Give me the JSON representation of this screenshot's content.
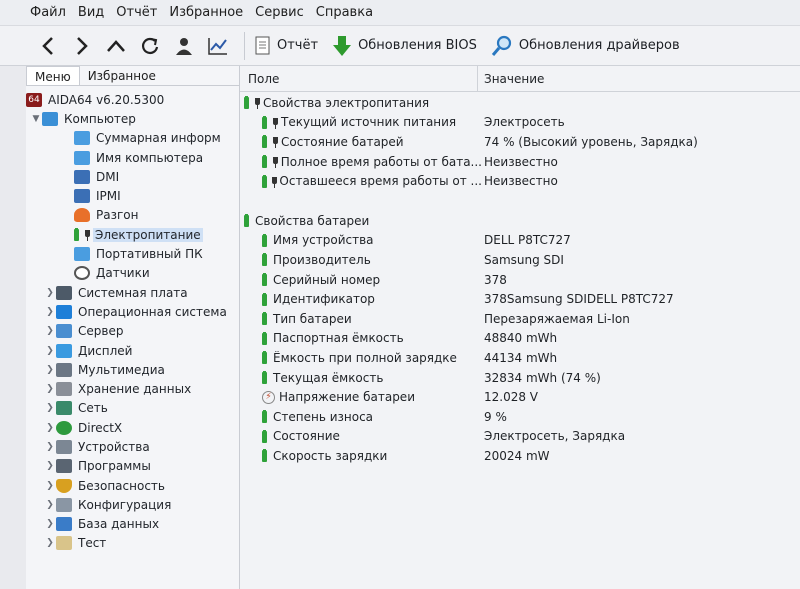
{
  "menu": [
    "Файл",
    "Вид",
    "Отчёт",
    "Избранное",
    "Сервис",
    "Справка"
  ],
  "toolbar": {
    "report": "Отчёт",
    "bios_updates": "Обновления BIOS",
    "driver_updates": "Обновления драйверов"
  },
  "left_tabs": [
    "Меню",
    "Избранное"
  ],
  "tree": {
    "root": "AIDA64 v6.20.5300",
    "computer": "Компьютер",
    "computer_children": [
      "Суммарная информ",
      "Имя компьютера",
      "DMI",
      "IPMI",
      "Разгон",
      "Электропитание",
      "Портативный ПК",
      "Датчики"
    ],
    "groups": [
      "Системная плата",
      "Операционная система",
      "Сервер",
      "Дисплей",
      "Мультимедиа",
      "Хранение данных",
      "Сеть",
      "DirectX",
      "Устройства",
      "Программы",
      "Безопасность",
      "Конфигурация",
      "База данных",
      "Тест"
    ]
  },
  "columns": {
    "field": "Поле",
    "value": "Значение"
  },
  "power_section": {
    "title": "Свойства электропитания",
    "rows": [
      {
        "field": "Текущий источник питания",
        "value": "Электросеть"
      },
      {
        "field": "Состояние батарей",
        "value": "74 % (Высокий уровень, Зарядка)"
      },
      {
        "field": "Полное время работы от бата...",
        "value": "Неизвестно"
      },
      {
        "field": "Оставшееся время работы от ...",
        "value": "Неизвестно"
      }
    ]
  },
  "battery_section": {
    "title": "Свойства батареи",
    "rows": [
      {
        "field": "Имя устройства",
        "value": "DELL P8TC727"
      },
      {
        "field": "Производитель",
        "value": "Samsung SDI"
      },
      {
        "field": "Серийный номер",
        "value": "378"
      },
      {
        "field": "Идентификатор",
        "value": "378Samsung SDIDELL P8TC727"
      },
      {
        "field": "Тип батареи",
        "value": "Перезаряжаемая Li-Ion"
      },
      {
        "field": "Паспортная ёмкость",
        "value": "48840 mWh"
      },
      {
        "field": "Ёмкость при полной зарядке",
        "value": "44134 mWh"
      },
      {
        "field": "Текущая ёмкость",
        "value": "32834 mWh  (74 %)"
      },
      {
        "field": "Напряжение батареи",
        "value": "12.028 V"
      },
      {
        "field": "Степень износа",
        "value": "9 %"
      },
      {
        "field": "Состояние",
        "value": "Электросеть, Зарядка"
      },
      {
        "field": "Скорость зарядки",
        "value": "20024 mW"
      }
    ]
  },
  "colors": {
    "battery": "#2fa23a",
    "selection": "#cfe0f5"
  }
}
